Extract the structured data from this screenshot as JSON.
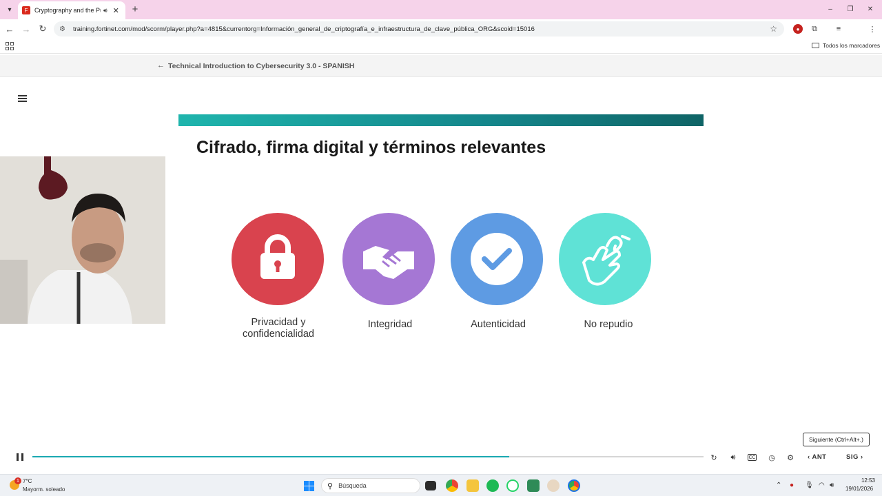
{
  "browser": {
    "tab": {
      "title": "Cryptography and the Publi",
      "audio_icon": "speaker-icon",
      "close_icon": "close-icon"
    },
    "new_tab_icon": "plus-icon",
    "window_controls": [
      "minimize-icon",
      "restore-icon",
      "close-icon"
    ],
    "address": {
      "url": "training.fortinet.com/mod/scorm/player.php?a=4815&currentorg=Información_general_de_criptografía_e_infraestructura_de_clave_pública_ORG&scoid=15016"
    },
    "bookmarks": {
      "all_label": "Todos los marcadores"
    }
  },
  "course": {
    "back_label": "←",
    "title": "Technical Introduction to Cybersecurity 3.0 - SPANISH"
  },
  "slide": {
    "title": "Cifrado, firma digital y términos relevantes",
    "items": [
      {
        "label_line1": "Privacidad y",
        "label_line2": "confidencialidad",
        "icon": "padlock-icon",
        "color": "#d9434e"
      },
      {
        "label_line1": "Integridad",
        "label_line2": "",
        "icon": "handshake-icon",
        "color": "#a577d4"
      },
      {
        "label_line1": "Autenticidad",
        "label_line2": "",
        "icon": "checkmark-icon",
        "color": "#5e9be3"
      },
      {
        "label_line1": "No repudio",
        "label_line2": "",
        "icon": "signing-hand-icon",
        "color": "#5fe2d6"
      }
    ],
    "accent_colors": [
      "#1fb5ad",
      "#0f6466"
    ]
  },
  "player": {
    "tooltip": "Siguiente (Ctrl+Alt+.)",
    "progress": 0.71,
    "prev_label": "ANT",
    "next_label": "SIG"
  },
  "taskbar": {
    "weather": {
      "badge": "1",
      "temp": "7°C",
      "desc": "Mayorm. soleado"
    },
    "search_label": "Búsqueda",
    "clock": {
      "time": "12:53",
      "date": "19/01/2026"
    }
  }
}
